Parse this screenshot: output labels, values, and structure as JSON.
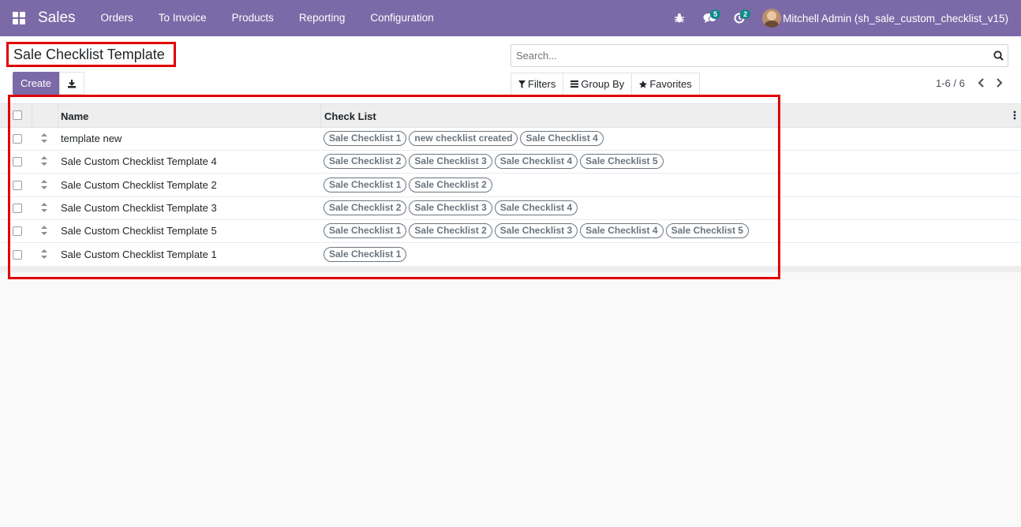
{
  "app": {
    "name": "Sales",
    "menu": [
      "Orders",
      "To Invoice",
      "Products",
      "Reporting",
      "Configuration"
    ],
    "messages_count": "5",
    "activities_count": "2",
    "user": "Mitchell Admin (sh_sale_custom_checklist_v15)"
  },
  "control_panel": {
    "title": "Sale Checklist Template",
    "create_label": "Create",
    "search_placeholder": "Search...",
    "filters_label": "Filters",
    "group_by_label": "Group By",
    "favorites_label": "Favorites",
    "pager": "1-6 / 6"
  },
  "table": {
    "columns": {
      "name": "Name",
      "checklist": "Check List"
    },
    "rows": [
      {
        "name": "template new",
        "tags": [
          "Sale Checklist 1",
          "new checklist created",
          "Sale Checklist 4"
        ]
      },
      {
        "name": "Sale Custom Checklist Template 4",
        "tags": [
          "Sale Checklist 2",
          "Sale Checklist 3",
          "Sale Checklist 4",
          "Sale Checklist 5"
        ]
      },
      {
        "name": "Sale Custom Checklist Template 2",
        "tags": [
          "Sale Checklist 1",
          "Sale Checklist 2"
        ]
      },
      {
        "name": "Sale Custom Checklist Template 3",
        "tags": [
          "Sale Checklist 2",
          "Sale Checklist 3",
          "Sale Checklist 4"
        ]
      },
      {
        "name": "Sale Custom Checklist Template 5",
        "tags": [
          "Sale Checklist 1",
          "Sale Checklist 2",
          "Sale Checklist 3",
          "Sale Checklist 4",
          "Sale Checklist 5"
        ]
      },
      {
        "name": "Sale Custom Checklist Template 1",
        "tags": [
          "Sale Checklist 1"
        ]
      }
    ]
  },
  "colors": {
    "brand": "#7c6aa8",
    "highlight": "#e00000",
    "badge": "#0d8a89"
  }
}
